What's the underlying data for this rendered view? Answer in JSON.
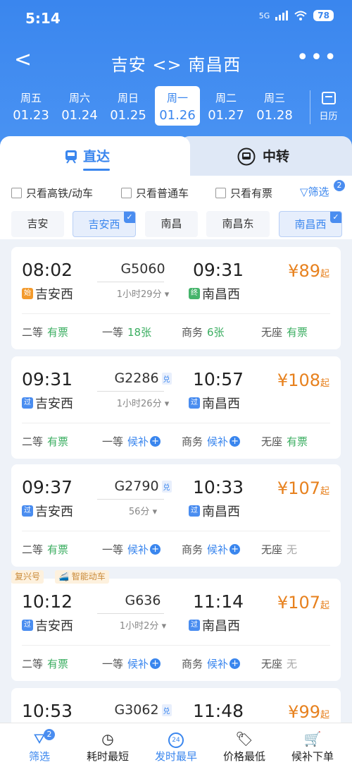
{
  "status": {
    "time": "5:14",
    "network": "5G",
    "battery": "78"
  },
  "nav": {
    "back": "<",
    "title": "吉安 <> 南昌西",
    "more": "•••"
  },
  "dates": [
    {
      "weekday": "周五",
      "date": "01.23"
    },
    {
      "weekday": "周六",
      "date": "01.24"
    },
    {
      "weekday": "周日",
      "date": "01.25"
    },
    {
      "weekday": "周一",
      "date": "01.26"
    },
    {
      "weekday": "周二",
      "date": "01.27"
    },
    {
      "weekday": "周三",
      "date": "01.28"
    }
  ],
  "calendar_label": "日历",
  "tabs": {
    "direct": "直达",
    "transfer": "中转"
  },
  "filters": {
    "gaotie": "只看高铁/动车",
    "putong": "只看普通车",
    "youpiao": "只看有票",
    "shaixuan": "筛选",
    "badge": "2"
  },
  "stations": [
    "吉安",
    "吉安西",
    "南昌",
    "南昌东",
    "南昌西"
  ],
  "trains": [
    {
      "dep": "08:02",
      "no": "G5060",
      "dui": "",
      "dur": "1小时29分",
      "arr": "09:31",
      "from_tag": "始",
      "from": "吉安西",
      "to_tag": "终",
      "to": "南昌西",
      "price": "¥89",
      "qi": "起",
      "seats": [
        {
          "c": "二等",
          "v": "有票"
        },
        {
          "c": "一等",
          "v": "18张"
        },
        {
          "c": "商务",
          "v": "6张"
        },
        {
          "c": "无座",
          "v": "有票"
        }
      ]
    },
    {
      "dep": "09:31",
      "no": "G2286",
      "dui": "兑",
      "dur": "1小时26分",
      "arr": "10:57",
      "from_tag": "过",
      "from": "吉安西",
      "to_tag": "过",
      "to": "南昌西",
      "price": "¥108",
      "qi": "起",
      "seats": [
        {
          "c": "二等",
          "v": "有票"
        },
        {
          "c": "一等",
          "v": "候补"
        },
        {
          "c": "商务",
          "v": "候补"
        },
        {
          "c": "无座",
          "v": "有票"
        }
      ]
    },
    {
      "dep": "09:37",
      "no": "G2790",
      "dui": "兑",
      "dur": "56分",
      "arr": "10:33",
      "from_tag": "过",
      "from": "吉安西",
      "to_tag": "过",
      "to": "南昌西",
      "price": "¥107",
      "qi": "起",
      "seats": [
        {
          "c": "二等",
          "v": "有票"
        },
        {
          "c": "一等",
          "v": "候补"
        },
        {
          "c": "商务",
          "v": "候补"
        },
        {
          "c": "无座",
          "v": "无"
        }
      ]
    },
    {
      "dep": "10:12",
      "no": "G636",
      "dui": "",
      "dur": "1小时2分",
      "arr": "11:14",
      "from_tag": "过",
      "from": "吉安西",
      "to_tag": "过",
      "to": "南昌西",
      "price": "¥107",
      "qi": "起",
      "ribbon1": "复兴号",
      "ribbon2": "智能动车",
      "seats": [
        {
          "c": "二等",
          "v": "有票"
        },
        {
          "c": "一等",
          "v": "候补"
        },
        {
          "c": "商务",
          "v": "候补"
        },
        {
          "c": "无座",
          "v": "无"
        }
      ]
    },
    {
      "dep": "10:53",
      "no": "G3062",
      "dui": "兑",
      "arr": "11:48",
      "price": "¥99",
      "qi": "起"
    }
  ],
  "bottom": [
    {
      "label": "筛选",
      "icon": "funnel-icon",
      "badge": "2"
    },
    {
      "label": "耗时最短",
      "icon": "clock-icon"
    },
    {
      "label": "发时最早",
      "icon": "24h-icon",
      "ic": "24"
    },
    {
      "label": "价格最低",
      "icon": "price-tag-icon"
    },
    {
      "label": "候补下单",
      "icon": "cart-icon"
    }
  ],
  "colors": {
    "accent": "#3a86ee",
    "price": "#e7811e",
    "available": "#3bae61"
  }
}
